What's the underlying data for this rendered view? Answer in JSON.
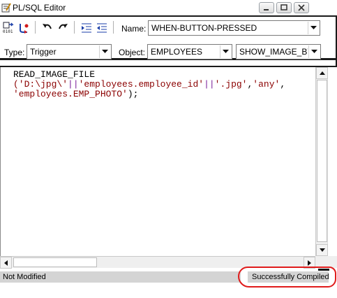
{
  "window": {
    "title": "PL/SQL Editor"
  },
  "toolbar": {
    "name_label": "Name:",
    "name_value": "WHEN-BUTTON-PRESSED",
    "type_label": "Type:",
    "type_value": "Trigger",
    "object_label": "Object:",
    "object_value": "EMPLOYEES",
    "item_value": "SHOW_IMAGE_BTN"
  },
  "editor": {
    "line1": "READ_IMAGE_FILE",
    "line2_parts": [
      "('D:\\jpg\\'",
      "||",
      "'employees.employee_id'",
      "||",
      "'.jpg'",
      ",",
      "'any'",
      ","
    ],
    "line3_parts": [
      "'employees.EMP_PHOTO'",
      ");"
    ]
  },
  "status": {
    "modified": "Not Modified",
    "compiled": "Successfully Compiled"
  },
  "colors": {
    "string": "#8b0000",
    "operator": "#7a1f9a",
    "annotation": "#e01b1b"
  },
  "icons": [
    "editor-app-icon",
    "compile-icon",
    "revert-icon",
    "undo-icon",
    "redo-icon",
    "indent-icon",
    "unindent-icon",
    "minimize-icon",
    "maximize-icon",
    "close-icon",
    "dropdown-arrow-icon"
  ]
}
